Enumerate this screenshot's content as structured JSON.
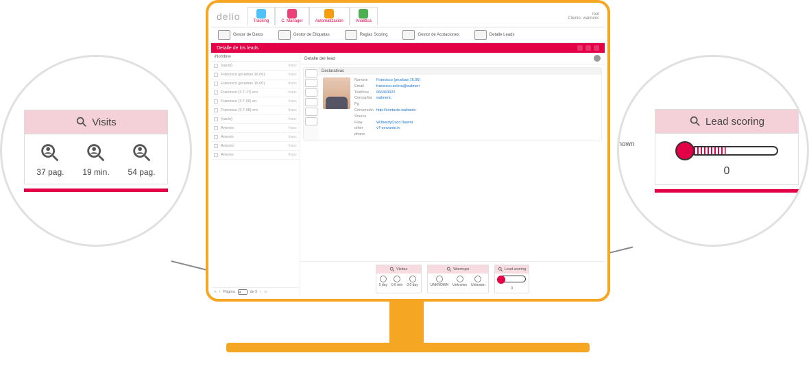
{
  "app": {
    "brand": "delio",
    "user_label": "root",
    "client_label": "Cliente: walmeric",
    "topnav": [
      {
        "label": "Tracking"
      },
      {
        "label": "C. Manager"
      },
      {
        "label": "Automatización"
      },
      {
        "label": "Analítica"
      }
    ],
    "ribbon": [
      {
        "label": "Gestor de Datos"
      },
      {
        "label": "Gestor de Etiquetas"
      },
      {
        "label": "Reglas Scoring"
      },
      {
        "label": "Gestor de Acotaciones"
      },
      {
        "label": "Detalle Leads"
      }
    ],
    "panel_title": "Detalle de los leads",
    "list": {
      "header": "Nombre",
      "rows": [
        "(vacío)",
        "Francisco (pruebas 16.06)",
        "Francisco (pruebas 16.06)",
        "Francisco (3.7-17) em",
        "Francisco (3.7-06) en",
        "Francisco (3.7-08) em",
        "(vacío)",
        "Antonio",
        "Antonio",
        "Antonio",
        "Antonio"
      ],
      "paginator_label": "Página",
      "paginator_of": "de 5"
    },
    "detail": {
      "header": "Detalle del lead",
      "section": "Declarativas",
      "fields": [
        {
          "lbl": "Nombre",
          "val": "Francisco (pruebas 16.06)"
        },
        {
          "lbl": "Email",
          "val": "francisco.solera@walmeri"
        },
        {
          "lbl": "Teléfono",
          "val": "666363922"
        },
        {
          "lbl": "Compañía",
          "val": "walmeric"
        },
        {
          "lbl": "Pg Conversión",
          "val": "http://contacto.walmeric"
        },
        {
          "lbl": "Source",
          "val": ""
        },
        {
          "lbl": "Flow",
          "val": "W3bwidyOucoTlawml"
        },
        {
          "lbl": "other",
          "val": "v7-servante.in"
        },
        {
          "lbl": "phone",
          "val": ""
        }
      ]
    },
    "footer_widgets": {
      "visits": {
        "title": "Visitas",
        "stats": [
          {
            "v": "0 day"
          },
          {
            "v": "0.0 min"
          },
          {
            "v": "0.0 day"
          }
        ]
      },
      "warmup": {
        "title": "Warmups",
        "stats": [
          {
            "v": "UNKNOWN"
          },
          {
            "v": "Unknown"
          },
          {
            "v": "Unknown"
          }
        ]
      },
      "scoring": {
        "title": "Lead scoring",
        "value": "0"
      }
    }
  },
  "callout_left": {
    "title": "Visits",
    "stats": [
      {
        "value": "37 pag."
      },
      {
        "value": "19 min."
      },
      {
        "value": "54 pag."
      }
    ]
  },
  "callout_right": {
    "title": "Lead scoring",
    "value": "0",
    "partial_label": "nknown"
  }
}
